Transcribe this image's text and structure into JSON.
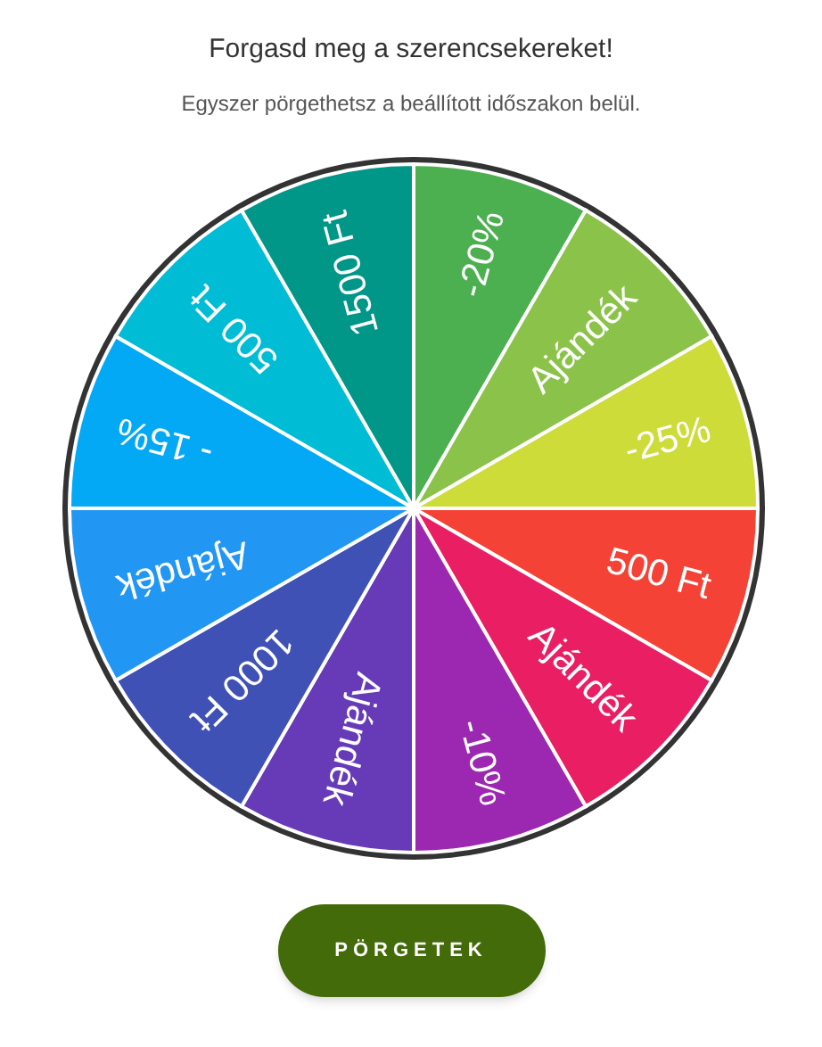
{
  "title": "Forgasd meg a szerencsekereket!",
  "subtitle": "Egyszer pörgethetsz a beállított időszakon belül.",
  "wheel": {
    "segments": [
      {
        "label": "-20%",
        "color": "#4caf50"
      },
      {
        "label": "Ajándék",
        "color": "#8bc34a"
      },
      {
        "label": "-25%",
        "color": "#cddc39"
      },
      {
        "label": "500 Ft",
        "color": "#f44336"
      },
      {
        "label": "Ajándék",
        "color": "#e91e63"
      },
      {
        "label": "-10%",
        "color": "#9c27b0"
      },
      {
        "label": "Ajándék",
        "color": "#673ab7"
      },
      {
        "label": "1000 Ft",
        "color": "#3f51b5"
      },
      {
        "label": "Ajándék",
        "color": "#2196f3"
      },
      {
        "label": "- 15%",
        "color": "#03a9f4"
      },
      {
        "label": "500 Ft",
        "color": "#00bcd4"
      },
      {
        "label": "1500 Ft",
        "color": "#009688"
      }
    ]
  },
  "button": "PÖRGETEK"
}
